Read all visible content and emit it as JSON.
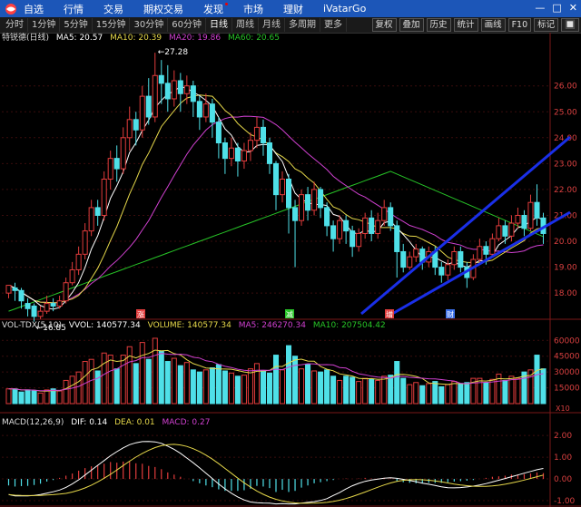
{
  "nav": {
    "items": [
      "自选",
      "行情",
      "交易",
      "期权交易",
      "发现",
      "市场",
      "理财",
      "iVatarGo"
    ],
    "window_buttons": [
      "—",
      "□",
      "✕"
    ]
  },
  "toolbar": {
    "periods": [
      "分时",
      "1分钟",
      "5分钟",
      "15分钟",
      "30分钟",
      "60分钟",
      "日线",
      "周线",
      "月线",
      "多周期",
      "更多"
    ],
    "active_period": "日线",
    "tools": [
      "复权",
      "叠加",
      "历史",
      "统计",
      "画线",
      "F10",
      "标记"
    ],
    "tools_extra": "🔲"
  },
  "main_info": {
    "name": "特锐德(日线)",
    "ma5": "MA5: 20.57",
    "ma10": "MA10: 20.39",
    "ma20": "MA20: 19.86",
    "ma60": "MA60: 20.65",
    "high_label": "27.28",
    "low_label": "←16.85"
  },
  "vol_info": {
    "name": "VOL-TDX(5,10)",
    "vvol": "VVOL: 140577.34",
    "volume": "VOLUME: 140577.34",
    "ma5": "MA5: 246270.34",
    "ma10": "MA10: 207504.42"
  },
  "macd_info": {
    "name": "MACD(12,26,9)",
    "dif": "DIF: 0.14",
    "dea": "DEA: 0.01",
    "macd": "MACD: 0.27"
  },
  "price_axis": [
    "26.00",
    "25.00",
    "24.00",
    "23.00",
    "22.00",
    "21.00",
    "20.00",
    "19.00",
    "18.00"
  ],
  "vol_axis": [
    "60000",
    "45000",
    "30000",
    "15000"
  ],
  "vol_unit": "X10",
  "macd_axis": [
    "2.00",
    "1.00",
    "0.00",
    "-1.00"
  ],
  "event_markers": [
    "涨",
    "减",
    "增",
    "财"
  ],
  "colors": {
    "up": "#e23c3c",
    "down": "#4fe0e8",
    "ma5": "#ffffff",
    "ma10": "#e6d84a",
    "ma20": "#d040d0",
    "ma60": "#27c427",
    "trendline": "#1a2fe8",
    "nav_bg": "#1c56b8"
  },
  "chart_data": [
    {
      "type": "candlestick",
      "title": "特锐德(日线)",
      "ylim": [
        17.2,
        27.6
      ],
      "candles": [
        [
          18.0,
          18.3,
          17.8,
          18.3
        ],
        [
          18.2,
          18.1,
          17.7,
          18.4
        ],
        [
          18.1,
          17.7,
          17.4,
          18.2
        ],
        [
          17.6,
          17.4,
          17.1,
          17.8
        ],
        [
          17.5,
          17.1,
          16.9,
          17.6
        ],
        [
          17.1,
          17.3,
          17.0,
          17.5
        ],
        [
          17.3,
          17.6,
          17.2,
          17.9
        ],
        [
          17.6,
          17.5,
          17.3,
          17.8
        ],
        [
          17.5,
          17.7,
          17.4,
          17.9
        ],
        [
          17.7,
          18.4,
          17.6,
          18.6
        ],
        [
          18.4,
          18.9,
          18.3,
          19.2
        ],
        [
          18.9,
          19.5,
          18.7,
          19.8
        ],
        [
          19.5,
          20.4,
          19.3,
          20.7
        ],
        [
          20.4,
          21.3,
          20.2,
          21.6
        ],
        [
          21.3,
          21.0,
          20.6,
          21.6
        ],
        [
          21.0,
          22.4,
          20.8,
          22.7
        ],
        [
          22.4,
          23.2,
          22.0,
          23.5
        ],
        [
          23.2,
          22.8,
          22.3,
          23.7
        ],
        [
          22.8,
          24.0,
          22.6,
          24.4
        ],
        [
          24.0,
          24.7,
          23.5,
          25.2
        ],
        [
          24.7,
          24.3,
          23.7,
          25.0
        ],
        [
          24.3,
          25.6,
          24.0,
          26.0
        ],
        [
          25.6,
          24.8,
          24.5,
          26.3
        ],
        [
          24.8,
          26.4,
          24.6,
          27.28
        ],
        [
          26.4,
          26.1,
          25.3,
          27.0
        ],
        [
          26.1,
          25.5,
          25.0,
          26.8
        ],
        [
          25.5,
          26.2,
          25.2,
          26.6
        ],
        [
          26.2,
          25.7,
          25.0,
          26.5
        ],
        [
          25.7,
          26.0,
          25.3,
          26.4
        ],
        [
          26.0,
          25.4,
          24.8,
          26.2
        ],
        [
          25.4,
          24.8,
          24.3,
          25.6
        ],
        [
          24.8,
          25.3,
          24.6,
          25.7
        ],
        [
          25.3,
          24.6,
          24.0,
          25.5
        ],
        [
          24.6,
          23.8,
          23.2,
          24.8
        ],
        [
          23.8,
          23.2,
          22.6,
          24.0
        ],
        [
          23.2,
          23.6,
          22.9,
          24.0
        ],
        [
          23.6,
          23.1,
          22.5,
          23.8
        ],
        [
          23.1,
          23.5,
          22.8,
          23.8
        ],
        [
          23.5,
          23.9,
          23.1,
          24.2
        ],
        [
          23.9,
          24.4,
          23.6,
          24.8
        ],
        [
          24.4,
          23.8,
          23.3,
          24.7
        ],
        [
          23.8,
          23.0,
          22.6,
          24.0
        ],
        [
          23.0,
          21.8,
          21.2,
          23.1
        ],
        [
          21.8,
          22.4,
          21.5,
          22.7
        ],
        [
          22.4,
          21.3,
          20.3,
          22.6
        ],
        [
          21.3,
          20.8,
          19.0,
          21.6
        ],
        [
          20.8,
          21.8,
          20.6,
          22.0
        ],
        [
          21.8,
          21.2,
          20.8,
          22.1
        ],
        [
          21.2,
          22.0,
          21.0,
          22.3
        ],
        [
          22.0,
          21.3,
          20.9,
          22.1
        ],
        [
          21.3,
          20.6,
          20.2,
          21.5
        ],
        [
          20.6,
          20.1,
          19.6,
          20.8
        ],
        [
          20.1,
          20.8,
          19.9,
          21.0
        ],
        [
          20.8,
          20.4,
          19.9,
          21.0
        ],
        [
          20.4,
          19.8,
          19.4,
          20.6
        ],
        [
          19.8,
          20.3,
          19.6,
          20.5
        ],
        [
          20.3,
          20.9,
          20.1,
          21.1
        ],
        [
          20.9,
          20.3,
          20.0,
          21.2
        ],
        [
          20.3,
          20.8,
          20.1,
          21.1
        ],
        [
          20.8,
          21.3,
          20.6,
          21.6
        ],
        [
          21.3,
          20.6,
          20.4,
          21.5
        ],
        [
          20.6,
          19.6,
          18.6,
          20.8
        ],
        [
          19.6,
          19.0,
          18.8,
          19.9
        ],
        [
          19.0,
          19.4,
          18.9,
          19.6
        ],
        [
          19.4,
          19.7,
          19.2,
          19.9
        ],
        [
          19.7,
          19.2,
          18.9,
          19.8
        ],
        [
          19.2,
          19.6,
          19.0,
          19.8
        ],
        [
          19.6,
          19.0,
          18.7,
          19.8
        ],
        [
          19.0,
          18.7,
          18.4,
          19.2
        ],
        [
          18.7,
          19.1,
          18.5,
          19.3
        ],
        [
          19.1,
          19.6,
          18.9,
          19.8
        ],
        [
          19.6,
          19.0,
          18.8,
          19.8
        ],
        [
          19.0,
          18.6,
          18.2,
          19.2
        ],
        [
          18.6,
          19.3,
          18.5,
          19.5
        ],
        [
          19.3,
          19.8,
          19.2,
          20.1
        ],
        [
          19.8,
          19.5,
          19.1,
          20.0
        ],
        [
          19.5,
          20.1,
          19.4,
          20.3
        ],
        [
          20.1,
          20.6,
          20.0,
          20.9
        ],
        [
          20.6,
          20.2,
          19.9,
          20.8
        ],
        [
          20.2,
          20.7,
          20.0,
          21.0
        ],
        [
          20.7,
          21.0,
          20.5,
          21.3
        ],
        [
          21.0,
          20.5,
          20.2,
          21.2
        ],
        [
          20.5,
          21.5,
          20.4,
          21.8
        ],
        [
          21.5,
          20.9,
          20.6,
          22.2
        ],
        [
          20.9,
          20.3,
          19.9,
          21.1
        ]
      ]
    },
    {
      "type": "bar",
      "title": "VOL-TDX(5,10)",
      "ylim": [
        0,
        68000
      ],
      "values": [
        14000,
        14000,
        11000,
        13000,
        12000,
        10000,
        13000,
        14000,
        12000,
        22000,
        26000,
        30000,
        40000,
        42000,
        31000,
        48000,
        46000,
        33000,
        46000,
        54000,
        38000,
        58000,
        42000,
        62000,
        50000,
        40000,
        43000,
        36000,
        39000,
        32000,
        30000,
        32000,
        34000,
        37000,
        31000,
        29000,
        26000,
        27000,
        33000,
        38000,
        31000,
        29000,
        46000,
        32000,
        55000,
        45000,
        33000,
        37000,
        31000,
        30000,
        32000,
        26000,
        22000,
        26000,
        25000,
        21000,
        24000,
        23000,
        22000,
        26000,
        27000,
        40000,
        24000,
        18000,
        20000,
        17000,
        19000,
        21000,
        16000,
        18000,
        21000,
        19000,
        20000,
        24000,
        24000,
        20000,
        23000,
        28000,
        22000,
        26000,
        24000,
        30000,
        32000,
        46000,
        33000
      ]
    },
    {
      "type": "bar",
      "title": "MACD(12,26,9)",
      "ylim": [
        -1.0,
        2.3
      ],
      "values": [
        -0.3,
        -0.35,
        -0.33,
        -0.32,
        -0.28,
        -0.22,
        -0.12,
        -0.05,
        0.05,
        0.15,
        0.25,
        0.38,
        0.5,
        0.58,
        0.62,
        0.7,
        0.78,
        0.75,
        0.8,
        0.8,
        0.72,
        0.7,
        0.6,
        0.55,
        0.45,
        0.3,
        0.2,
        0.1,
        0.0,
        -0.1,
        -0.2,
        -0.3,
        -0.38,
        -0.48,
        -0.55,
        -0.55,
        -0.55,
        -0.52,
        -0.45,
        -0.32,
        -0.35,
        -0.42,
        -0.6,
        -0.5,
        -0.6,
        -0.55,
        -0.4,
        -0.3,
        -0.2,
        -0.15,
        -0.1,
        -0.05,
        0.0,
        0.02,
        0.0,
        0.02,
        0.05,
        0.02,
        0.02,
        0.05,
        0.02,
        -0.1,
        -0.15,
        -0.18,
        -0.2,
        -0.2,
        -0.18,
        -0.18,
        -0.18,
        -0.15,
        -0.12,
        -0.1,
        -0.08,
        -0.05,
        0.0,
        0.05,
        0.1,
        0.12,
        0.15,
        0.2,
        0.2,
        0.22,
        0.25,
        0.3,
        0.27
      ]
    }
  ]
}
